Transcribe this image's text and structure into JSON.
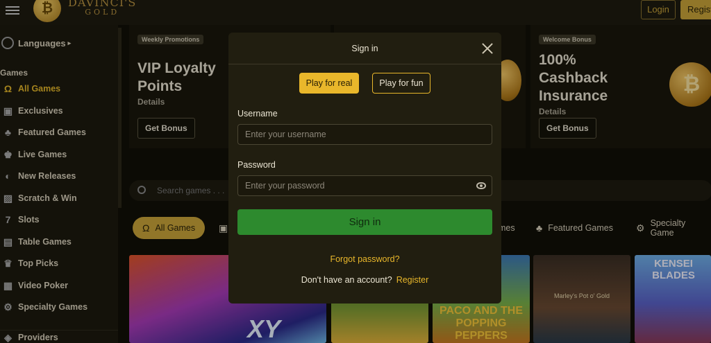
{
  "header": {
    "logo_text": "DAVINCI'S",
    "logo_sub": "GOLD",
    "login_label": "Login",
    "register_label": "Regist"
  },
  "sidebar": {
    "languages_label": "Languages",
    "section_label": "Games",
    "items": [
      {
        "label": "All Games",
        "icon": "horseshoe-icon"
      },
      {
        "label": "Exclusives",
        "icon": "exclusive-icon"
      },
      {
        "label": "Featured Games",
        "icon": "clover-icon"
      },
      {
        "label": "Live Games",
        "icon": "live-dealer-icon"
      },
      {
        "label": "New Releases",
        "icon": "new-icon"
      },
      {
        "label": "Scratch & Win",
        "icon": "scratch-card-icon"
      },
      {
        "label": "Slots",
        "icon": "seven-icon"
      },
      {
        "label": "Table Games",
        "icon": "cards-icon"
      },
      {
        "label": "Top Picks",
        "icon": "trophy-icon"
      },
      {
        "label": "Video Poker",
        "icon": "video-poker-icon"
      },
      {
        "label": "Specialty Games",
        "icon": "gear-icon"
      }
    ],
    "providers_label": "Providers"
  },
  "promos": [
    {
      "tag": "Weekly Promotions",
      "title": "VIP Loyalty Points",
      "details": "Details",
      "button": "Get Bonus"
    },
    {
      "tag": "Welcome Bonus",
      "title": "100% Cashback Insurance",
      "details": "Details",
      "button": "Get Bonus"
    }
  ],
  "search": {
    "placeholder": "Search games . . ."
  },
  "categories": [
    "All Games",
    "mes",
    "Featured Games",
    "Specialty Game"
  ],
  "game_tiles": [
    "XY",
    "PACO AND THE POPPING PEPPERS",
    "Marley's Pot o' Gold",
    "KENSEI BLADES"
  ],
  "modal": {
    "title": "Sign in",
    "mode_real": "Play for real",
    "mode_fun": "Play for fun",
    "username_label": "Username",
    "username_placeholder": "Enter your username",
    "password_label": "Password",
    "password_placeholder": "Enter your password",
    "signin_button": "Sign in",
    "forgot": "Forgot password?",
    "no_account": "Don't have an account?",
    "register_link": "Register"
  },
  "colors": {
    "accent": "#e9b72b",
    "signin_green": "#2d8a2e",
    "modal_bg": "#211e10"
  }
}
